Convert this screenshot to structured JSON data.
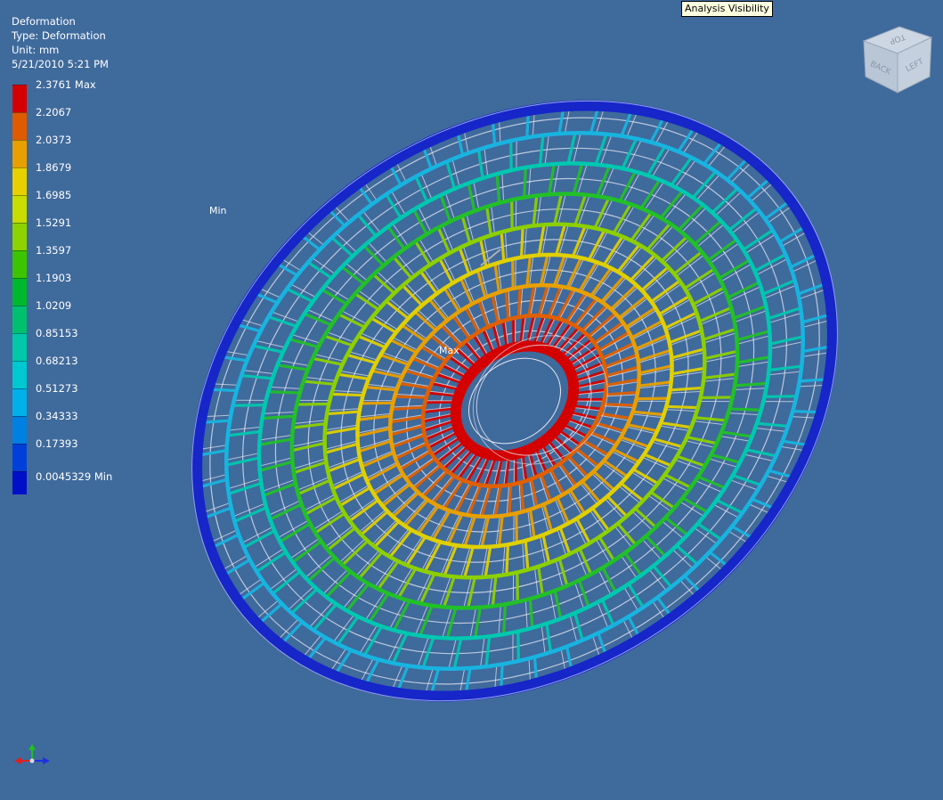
{
  "result_info": {
    "title": "Deformation",
    "type": "Type: Deformation",
    "unit": "Unit: mm",
    "timestamp": "5/21/2010 5:21 PM"
  },
  "legend": {
    "entries": [
      {
        "label": "2.3761 Max",
        "color": "#d40000"
      },
      {
        "label": "2.2067",
        "color": "#e05a00"
      },
      {
        "label": "2.0373",
        "color": "#e8a000"
      },
      {
        "label": "1.8679",
        "color": "#e8d000"
      },
      {
        "label": "1.6985",
        "color": "#c8dc00"
      },
      {
        "label": "1.5291",
        "color": "#8ed200"
      },
      {
        "label": "1.3597",
        "color": "#3cc400"
      },
      {
        "label": "1.1903",
        "color": "#00b82c"
      },
      {
        "label": "1.0209",
        "color": "#00c070"
      },
      {
        "label": "0.85153",
        "color": "#00c8a8"
      },
      {
        "label": "0.68213",
        "color": "#00c8d0"
      },
      {
        "label": "0.51273",
        "color": "#00b0e8"
      },
      {
        "label": "0.34333",
        "color": "#0080e0"
      },
      {
        "label": "0.17393",
        "color": "#0040d8"
      }
    ],
    "min_label": "0.0045329 Min",
    "min_color": "#0010c8"
  },
  "tooltip": "Analysis Visibility",
  "viewcube": {
    "top": "TOP",
    "back": "BACK",
    "left": "LEFT"
  },
  "markers": {
    "min": "Min",
    "max": "Max"
  },
  "colors": {
    "background": "#3f6a9c",
    "outer_rim": "#1626c8",
    "mesh_lines": "#e8e8f0"
  },
  "model": {
    "ring_count": 8,
    "spoke_count": 56
  }
}
